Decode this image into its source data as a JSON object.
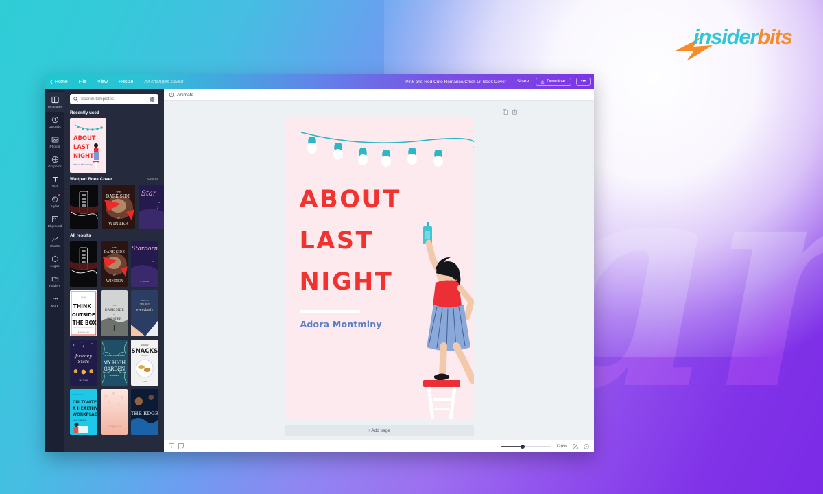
{
  "branding": {
    "logo_part1": "insider",
    "logo_part2": "bits",
    "logo_bolt": "lightning-bolt-icon",
    "color_cyan": "#2fc6d8",
    "color_orange": "#f68b28"
  },
  "background": {
    "gradient_start": "#2fcdd6",
    "gradient_end": "#7b2ae6",
    "watermark_text": "an"
  },
  "topbar": {
    "home": "Home",
    "file": "File",
    "view": "View",
    "resize": "Resize",
    "save_status": "All changes saved",
    "doc_title": "Pink and Red Cute Romance/Chick Lit Book Cover",
    "share": "Share",
    "download": "Download",
    "more": "•••"
  },
  "rail": {
    "items": [
      {
        "label": "Templates",
        "icon": "templates-icon",
        "active": true,
        "badge": false
      },
      {
        "label": "Uploads",
        "icon": "upload-icon",
        "active": false,
        "badge": false
      },
      {
        "label": "Photos",
        "icon": "photos-icon",
        "active": false,
        "badge": false
      },
      {
        "label": "Graphics",
        "icon": "graphics-icon",
        "active": false,
        "badge": false
      },
      {
        "label": "Text",
        "icon": "text-icon",
        "active": false,
        "badge": false
      },
      {
        "label": "Styles",
        "icon": "styles-icon",
        "active": false,
        "badge": true
      },
      {
        "label": "Bkground",
        "icon": "background-icon",
        "active": false,
        "badge": false
      },
      {
        "label": "Charts",
        "icon": "charts-icon",
        "active": false,
        "badge": false
      },
      {
        "label": "Logos",
        "icon": "logos-icon",
        "active": false,
        "badge": false
      },
      {
        "label": "Folders",
        "icon": "folder-icon",
        "active": false,
        "badge": false
      },
      {
        "label": "More",
        "icon": "more-icon",
        "active": false,
        "badge": false
      }
    ]
  },
  "panel": {
    "search_placeholder": "Search templates",
    "search_value": "",
    "filter_icon": "filter-icon",
    "recently_used_heading": "Recently used",
    "wattpad_heading": "Wattpad Book Cover",
    "see_all": "See all",
    "all_results_heading": "All results",
    "wattpad_row": [
      {
        "name": "thermometer-dark-cover"
      },
      {
        "name": "dark-side-of-winter-cover"
      },
      {
        "name": "starborn-cover"
      }
    ],
    "results_grid": [
      {
        "name": "thermometer-dark-cover"
      },
      {
        "name": "dark-side-of-winter-cover"
      },
      {
        "name": "starborn-cover"
      },
      {
        "name": "think-outside-the-box-cover"
      },
      {
        "name": "dark-side-of-winter-grey-cover"
      },
      {
        "name": "everybody-navy-cover"
      },
      {
        "name": "journey-to-the-stars-cover"
      },
      {
        "name": "my-high-garden-cover"
      },
      {
        "name": "snacks-cover"
      },
      {
        "name": "cultivate-a-healthy-workplace-cover"
      },
      {
        "name": "magnolia-cover"
      },
      {
        "name": "the-edge-cover"
      }
    ]
  },
  "editor": {
    "animate_label": "Animate",
    "animate_icon": "animate-icon",
    "duplicate_icon": "duplicate-page-icon",
    "export_icon": "export-page-icon",
    "add_page_label": "+ Add page"
  },
  "cover": {
    "line1": "ABOUT",
    "line2": "LAST",
    "line3": "NIGHT",
    "author": "Adora Montminy",
    "bg_color": "#fceaee",
    "title_color": "#f2322e",
    "author_color": "#5b7fc7",
    "lights_color": "#2bb8c4",
    "bulb_count": 6
  },
  "statusbar": {
    "page_icon": "page-number-icon",
    "notes_icon": "notes-icon",
    "zoom_level": "128%",
    "fullscreen_icon": "fullscreen-icon",
    "help_icon": "help-icon"
  }
}
